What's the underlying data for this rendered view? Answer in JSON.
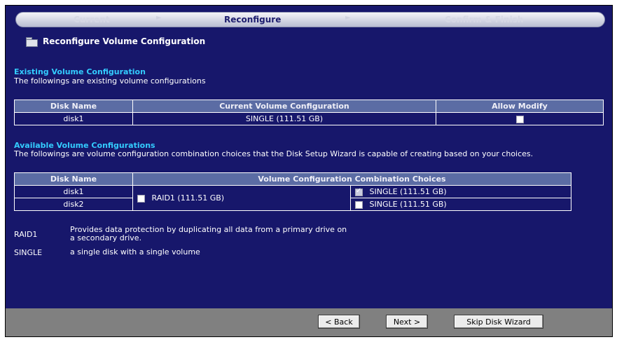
{
  "steps": [
    "Current",
    "Reconfigure",
    "Confirm & Finish"
  ],
  "page_title": "Reconfigure Volume Configuration",
  "existing": {
    "title": "Existing Volume Configuration",
    "description": "The followings are existing volume configurations",
    "headers": [
      "Disk Name",
      "Current Volume Configuration",
      "Allow Modify"
    ],
    "rows": [
      {
        "disk": "disk1",
        "config": "SINGLE (111.51 GB)",
        "allow_modify": false
      }
    ]
  },
  "available": {
    "title": "Available Volume Configurations",
    "description": "The followings are volume configuration combination choices that the Disk Setup Wizard is capable of creating based on your choices.",
    "headers": [
      "Disk Name",
      "Volume Configuration Combination Choices"
    ],
    "disks": [
      "disk1",
      "disk2"
    ],
    "raid1_choice": "RAID1 (111.51 GB)",
    "single_choices": [
      "SINGLE (111.51 GB)",
      "SINGLE (111.51 GB)"
    ]
  },
  "legend": [
    {
      "term": "RAID1",
      "definition_line1": "Provides data protection by duplicating all data from a primary drive on",
      "definition_line2": "a secondary drive."
    },
    {
      "term": "SINGLE",
      "definition_line1": "a single disk with a single volume"
    }
  ],
  "buttons": {
    "back": "< Back",
    "next": "Next >",
    "skip": "Skip Disk Wizard"
  }
}
